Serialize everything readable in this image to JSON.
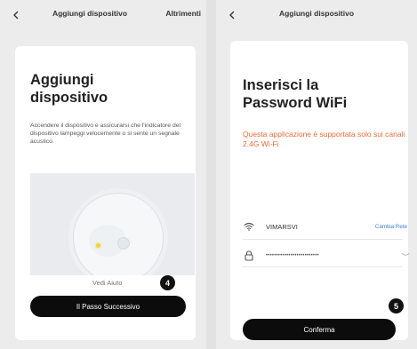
{
  "left_screen": {
    "back_icon": "chevron-left-icon",
    "title": "Aggiungi dispositivo",
    "other_action": "Altrimenti",
    "heading": "Aggiungi dispositivo",
    "description": "Accendere il dispositivo e assicurarsi che l'indicatore del dispositivo lampeggi velocemente o si sente un segnale acustico.",
    "illustration": {
      "indicator_color": "#f3d23a"
    },
    "help_link": "Vedi Aiuto",
    "step_badge": "4",
    "next_button": "Il Passo Successivo"
  },
  "right_screen": {
    "back_icon": "chevron-left-icon",
    "title": "Aggiungi dispositivo",
    "heading": "Inserisci la Password WiFi",
    "warning": "Questa applicazione è supportata solo sui canali 2.4G Wi-Fi",
    "wifi_field": {
      "icon": "wifi-icon",
      "ssid": "VIMARSVI",
      "change_network": "Cambia Rete"
    },
    "password_field": {
      "icon": "lock-icon",
      "value": "••••••••••••••••••••••••••",
      "toggle_icon": "eye-icon"
    },
    "step_badge": "5",
    "confirm_button": "Conferma"
  },
  "colors": {
    "accent_warning": "#f06a35",
    "link": "#3d7ddb",
    "button": "#0c0c0c"
  }
}
